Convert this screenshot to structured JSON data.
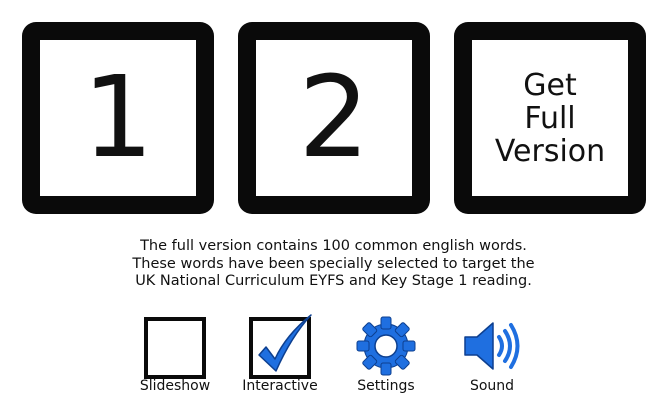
{
  "tiles": [
    {
      "label": "1"
    },
    {
      "label": "2"
    },
    {
      "label_lines": [
        "Get",
        "Full",
        "Version"
      ]
    }
  ],
  "info": {
    "lines": [
      "The full version contains 100 common english words.",
      "These words have been specially selected to target the",
      "UK National Curriculum EYFS and Key Stage 1 reading."
    ]
  },
  "options": {
    "slideshow": {
      "label": "Slideshow",
      "checked": false
    },
    "interactive": {
      "label": "Interactive",
      "checked": true
    },
    "settings": {
      "label": "Settings",
      "icon": "gear-icon"
    },
    "sound": {
      "label": "Sound",
      "icon": "speaker-icon"
    }
  },
  "colors": {
    "tile_border": "#0a0a0a",
    "accent_blue": "#1f6fe0"
  }
}
